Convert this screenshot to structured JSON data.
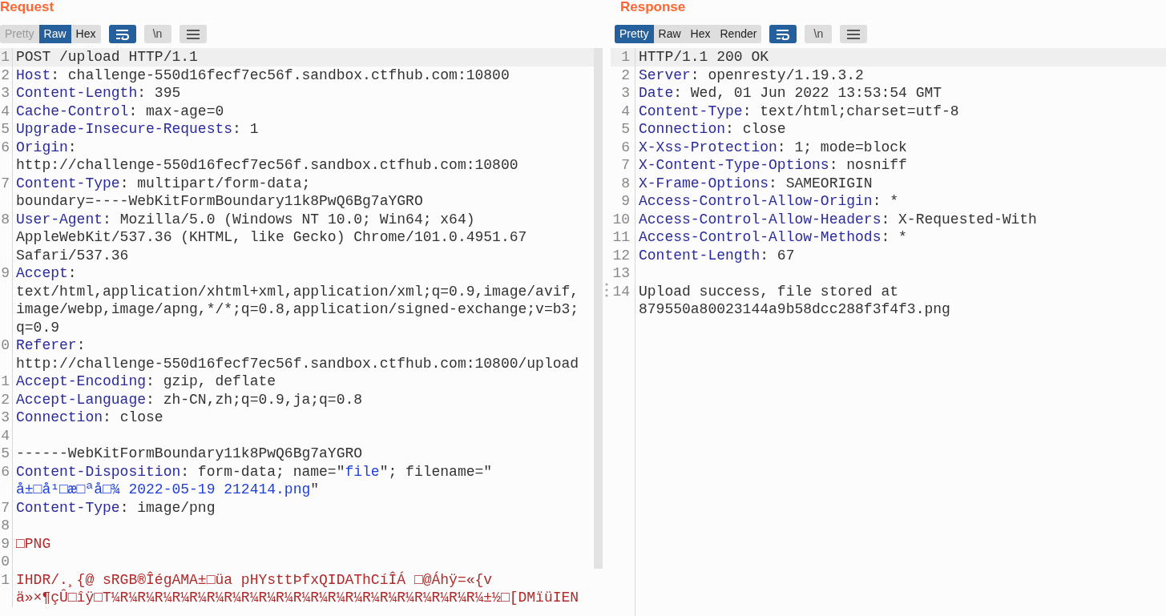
{
  "request": {
    "title": "Request",
    "view_tabs": [
      {
        "label": "Pretty",
        "selected": false,
        "disabled": true
      },
      {
        "label": "Raw",
        "selected": true,
        "disabled": false
      },
      {
        "label": "Hex",
        "selected": false,
        "disabled": false
      }
    ],
    "wrap_on": true,
    "newline_label": "\\n",
    "lines": [
      {
        "number": "1",
        "current": true,
        "rows": [
          [
            {
              "kind": "plain",
              "text": "POST /upload HTTP/1.1"
            }
          ]
        ]
      },
      {
        "number": "2",
        "current": false,
        "rows": [
          [
            {
              "kind": "name",
              "text": "Host"
            },
            {
              "kind": "plain",
              "text": ": challenge-550d16fecf7ec56f.sandbox.ctfhub.com:10800"
            }
          ]
        ]
      },
      {
        "number": "3",
        "current": false,
        "rows": [
          [
            {
              "kind": "name",
              "text": "Content-Length"
            },
            {
              "kind": "plain",
              "text": ": 395"
            }
          ]
        ]
      },
      {
        "number": "4",
        "current": false,
        "rows": [
          [
            {
              "kind": "name",
              "text": "Cache-Control"
            },
            {
              "kind": "plain",
              "text": ": max-age=0"
            }
          ]
        ]
      },
      {
        "number": "5",
        "current": false,
        "rows": [
          [
            {
              "kind": "name",
              "text": "Upgrade-Insecure-Requests"
            },
            {
              "kind": "plain",
              "text": ": 1"
            }
          ]
        ]
      },
      {
        "number": "6",
        "current": false,
        "rows": [
          [
            {
              "kind": "name",
              "text": "Origin"
            },
            {
              "kind": "plain",
              "text": ":"
            }
          ],
          [
            {
              "kind": "plain",
              "text": "http://challenge-550d16fecf7ec56f.sandbox.ctfhub.com:10800"
            }
          ]
        ]
      },
      {
        "number": "7",
        "current": false,
        "rows": [
          [
            {
              "kind": "name",
              "text": "Content-Type"
            },
            {
              "kind": "plain",
              "text": ": multipart/form-data;"
            }
          ],
          [
            {
              "kind": "plain",
              "text": "boundary=----WebKitFormBoundary11k8PwQ6Bg7aYGRO"
            }
          ]
        ]
      },
      {
        "number": "8",
        "current": false,
        "rows": [
          [
            {
              "kind": "name",
              "text": "User-Agent"
            },
            {
              "kind": "plain",
              "text": ": Mozilla/5.0 (Windows NT 10.0; Win64; x64)"
            }
          ],
          [
            {
              "kind": "plain",
              "text": "AppleWebKit/537.36 (KHTML, like Gecko) Chrome/101.0.4951.67"
            }
          ],
          [
            {
              "kind": "plain",
              "text": "Safari/537.36"
            }
          ]
        ]
      },
      {
        "number": "9",
        "current": false,
        "rows": [
          [
            {
              "kind": "name",
              "text": "Accept"
            },
            {
              "kind": "plain",
              "text": ":"
            }
          ],
          [
            {
              "kind": "plain",
              "text": "text/html,application/xhtml+xml,application/xml;q=0.9,image/avif,"
            }
          ],
          [
            {
              "kind": "plain",
              "text": "image/webp,image/apng,*/*;q=0.8,application/signed-exchange;v=b3;"
            }
          ],
          [
            {
              "kind": "plain",
              "text": "q=0.9"
            }
          ]
        ]
      },
      {
        "number": "0",
        "current": false,
        "rows": [
          [
            {
              "kind": "name",
              "text": "Referer"
            },
            {
              "kind": "plain",
              "text": ":"
            }
          ],
          [
            {
              "kind": "plain",
              "text": "http://challenge-550d16fecf7ec56f.sandbox.ctfhub.com:10800/upload"
            }
          ]
        ]
      },
      {
        "number": "1",
        "current": false,
        "rows": [
          [
            {
              "kind": "name",
              "text": "Accept-Encoding"
            },
            {
              "kind": "plain",
              "text": ": gzip, deflate"
            }
          ]
        ]
      },
      {
        "number": "2",
        "current": false,
        "rows": [
          [
            {
              "kind": "name",
              "text": "Accept-Language"
            },
            {
              "kind": "plain",
              "text": ": zh-CN,zh;q=0.9,ja;q=0.8"
            }
          ]
        ]
      },
      {
        "number": "3",
        "current": false,
        "rows": [
          [
            {
              "kind": "name",
              "text": "Connection"
            },
            {
              "kind": "plain",
              "text": ": close"
            }
          ]
        ]
      },
      {
        "number": "4",
        "current": false,
        "rows": [
          []
        ]
      },
      {
        "number": "5",
        "current": false,
        "rows": [
          [
            {
              "kind": "plain",
              "text": "------WebKitFormBoundary11k8PwQ6Bg7aYGRO"
            }
          ]
        ]
      },
      {
        "number": "6",
        "current": false,
        "rows": [
          [
            {
              "kind": "name",
              "text": "Content-Disposition"
            },
            {
              "kind": "plain",
              "text": ": form-data; name=\""
            },
            {
              "kind": "value",
              "text": "file"
            },
            {
              "kind": "plain",
              "text": "\"; filename=\""
            }
          ],
          [
            {
              "kind": "value",
              "text": "å±□å¹□æ□ªå□¾ 2022-05-19 212414.png"
            },
            {
              "kind": "plain",
              "text": "\""
            }
          ]
        ]
      },
      {
        "number": "7",
        "current": false,
        "rows": [
          [
            {
              "kind": "name",
              "text": "Content-Type"
            },
            {
              "kind": "plain",
              "text": ": image/png"
            }
          ]
        ]
      },
      {
        "number": "8",
        "current": false,
        "rows": [
          []
        ]
      },
      {
        "number": "9",
        "current": false,
        "rows": [
          [
            {
              "kind": "binary",
              "text": "□PNG"
            }
          ]
        ]
      },
      {
        "number": "0",
        "current": false,
        "rows": [
          []
        ]
      },
      {
        "number": "1",
        "current": false,
        "rows": [
          [
            {
              "kind": "binary",
              "text": "IHDR/.¸{@ sRGB®ÎégAMA±□üa pHYsttÞfxQIDAThCíÎÁ □@Áhÿ=«{v"
            }
          ],
          [
            {
              "kind": "binary",
              "text": "ä»×¶çÛ□îÿ□T¼R¼R¼R¼R¼R¼R¼R¼R¼R¼R¼R¼R¼R¼R¼R¼R¼R¼R¼R¼R¼R¼±½□[DMïüIEN"
            }
          ]
        ]
      }
    ]
  },
  "response": {
    "title": "Response",
    "view_tabs": [
      {
        "label": "Pretty",
        "selected": true,
        "disabled": false
      },
      {
        "label": "Raw",
        "selected": false,
        "disabled": false
      },
      {
        "label": "Hex",
        "selected": false,
        "disabled": false
      },
      {
        "label": "Render",
        "selected": false,
        "disabled": false
      }
    ],
    "wrap_on": true,
    "newline_label": "\\n",
    "lines": [
      {
        "number": "1",
        "current": true,
        "rows": [
          [
            {
              "kind": "plain",
              "text": "HTTP/1.1 200 OK"
            }
          ]
        ]
      },
      {
        "number": "2",
        "current": false,
        "rows": [
          [
            {
              "kind": "name",
              "text": "Server"
            },
            {
              "kind": "plain",
              "text": ": openresty/1.19.3.2"
            }
          ]
        ]
      },
      {
        "number": "3",
        "current": false,
        "rows": [
          [
            {
              "kind": "name",
              "text": "Date"
            },
            {
              "kind": "plain",
              "text": ": Wed, 01 Jun 2022 13:53:54 GMT"
            }
          ]
        ]
      },
      {
        "number": "4",
        "current": false,
        "rows": [
          [
            {
              "kind": "name",
              "text": "Content-Type"
            },
            {
              "kind": "plain",
              "text": ": text/html;charset=utf-8"
            }
          ]
        ]
      },
      {
        "number": "5",
        "current": false,
        "rows": [
          [
            {
              "kind": "name",
              "text": "Connection"
            },
            {
              "kind": "plain",
              "text": ": close"
            }
          ]
        ]
      },
      {
        "number": "6",
        "current": false,
        "rows": [
          [
            {
              "kind": "name",
              "text": "X-Xss-Protection"
            },
            {
              "kind": "plain",
              "text": ": 1; mode=block"
            }
          ]
        ]
      },
      {
        "number": "7",
        "current": false,
        "rows": [
          [
            {
              "kind": "name",
              "text": "X-Content-Type-Options"
            },
            {
              "kind": "plain",
              "text": ": nosniff"
            }
          ]
        ]
      },
      {
        "number": "8",
        "current": false,
        "rows": [
          [
            {
              "kind": "name",
              "text": "X-Frame-Options"
            },
            {
              "kind": "plain",
              "text": ": SAMEORIGIN"
            }
          ]
        ]
      },
      {
        "number": "9",
        "current": false,
        "rows": [
          [
            {
              "kind": "name",
              "text": "Access-Control-Allow-Origin"
            },
            {
              "kind": "plain",
              "text": ": *"
            }
          ]
        ]
      },
      {
        "number": "10",
        "current": false,
        "rows": [
          [
            {
              "kind": "name",
              "text": "Access-Control-Allow-Headers"
            },
            {
              "kind": "plain",
              "text": ": X-Requested-With"
            }
          ]
        ]
      },
      {
        "number": "11",
        "current": false,
        "rows": [
          [
            {
              "kind": "name",
              "text": "Access-Control-Allow-Methods"
            },
            {
              "kind": "plain",
              "text": ": *"
            }
          ]
        ]
      },
      {
        "number": "12",
        "current": false,
        "rows": [
          [
            {
              "kind": "name",
              "text": "Content-Length"
            },
            {
              "kind": "plain",
              "text": ": 67"
            }
          ]
        ]
      },
      {
        "number": "13",
        "current": false,
        "rows": [
          []
        ]
      },
      {
        "number": "14",
        "current": false,
        "rows": [
          [
            {
              "kind": "plain",
              "text": "Upload success, file stored at"
            }
          ],
          [
            {
              "kind": "plain",
              "text": "879550a80023144a9b58dcc288f3f4f3.png"
            }
          ]
        ]
      }
    ]
  }
}
